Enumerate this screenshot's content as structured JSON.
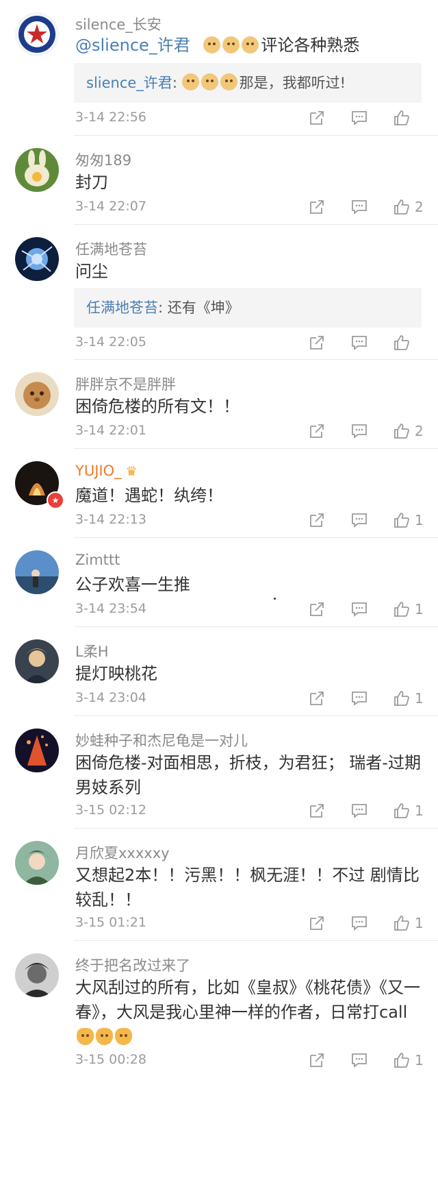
{
  "comments": [
    {
      "username": "silence_长安",
      "body": {
        "mention": "@slience_许君",
        "text": "评论各种熟悉",
        "emojis": 3,
        "emoji_type": "dog"
      },
      "reply": {
        "name": "slience_许君",
        "sep": ": ",
        "text": "那是，我都听过!",
        "emojis": 3
      },
      "time": "3-14 22:56",
      "likes": "",
      "avatar": {
        "bg": "#f4f4f4",
        "accent": "#1d3c8c",
        "secondary": "#cc2a2a"
      }
    },
    {
      "username": "匆匆189",
      "body": {
        "text": "封刀"
      },
      "time": "3-14 22:07",
      "likes": "2",
      "avatar": {
        "bg": "#5f8a3a",
        "accent": "#f0ead0",
        "secondary": "#f2b93b"
      }
    },
    {
      "username": "任满地苍苔",
      "body": {
        "text": "问尘"
      },
      "reply": {
        "name": "任满地苍苔",
        "sep": ": ",
        "text": "还有《坤》"
      },
      "time": "3-14 22:05",
      "likes": "",
      "avatar": {
        "bg": "#0d1f3c",
        "accent": "#6fa8e8",
        "secondary": "#cfe3ff"
      }
    },
    {
      "username": "胖胖京不是胖胖",
      "body": {
        "text": "困倚危楼的所有文！！"
      },
      "time": "3-14 22:01",
      "likes": "2",
      "avatar": {
        "bg": "#e9dcc2",
        "accent": "#c58a4d",
        "secondary": "#8b5a2b"
      }
    },
    {
      "username": "YUJIO_",
      "vip": true,
      "body": {
        "text": "魔道！遇蛇！纨绔！"
      },
      "time": "3-14 22:13",
      "likes": "1",
      "avatar": {
        "bg": "#1a1410",
        "accent": "#d88d3a",
        "secondary": "#f6d58a"
      }
    },
    {
      "username": "Zimttt",
      "body": {
        "text": "公子欢喜一生推"
      },
      "time": "3-14 23:54",
      "likes": "1",
      "avatar": {
        "bg": "#5a8fc9",
        "accent": "#2d4e70",
        "secondary": "#e8d6c0"
      }
    },
    {
      "username": "L柔H",
      "body": {
        "text": "提灯映桃花"
      },
      "time": "3-14 23:04",
      "likes": "1",
      "avatar": {
        "bg": "#39424f",
        "accent": "#e7c59a",
        "secondary": "#c9a16a"
      }
    },
    {
      "username": "妙蛙种子和杰尼龟是一对儿",
      "body": {
        "text": "困倚危楼-对面相思，折枝，为君狂； 瑞者-过期男妓系列"
      },
      "time": "3-15 02:12",
      "likes": "1",
      "avatar": {
        "bg": "#15102a",
        "accent": "#e0542c",
        "secondary": "#f3a23b"
      }
    },
    {
      "username": "月欣夏xxxxxy",
      "body": {
        "text": "又想起2本！！污黑！！枫无涯！！不过 剧情比较乱！！"
      },
      "time": "3-15 01:21",
      "likes": "1",
      "avatar": {
        "bg": "#8fb6a0",
        "accent": "#f0d9c0",
        "secondary": "#3b5d3b"
      }
    },
    {
      "username": "终于把名改过来了",
      "body": {
        "text": "大风刮过的所有，比如《皇叔》《桃花债》《又一春》，大风是我心里神一样的作者，日常打call",
        "emojis_after": 3,
        "emoji_type": "hand"
      },
      "time": "3-15 00:28",
      "likes": "1",
      "avatar": {
        "bg": "#cfcfcf",
        "accent": "#2a2a2a",
        "secondary": "#6b6b6b"
      }
    }
  ],
  "icons": {
    "share": "share-icon",
    "comment": "comment-icon",
    "like": "thumbs-up-icon"
  },
  "colors": {
    "link": "#4a7fb3",
    "meta": "#9b9b9b",
    "vip": "#f07a28"
  }
}
